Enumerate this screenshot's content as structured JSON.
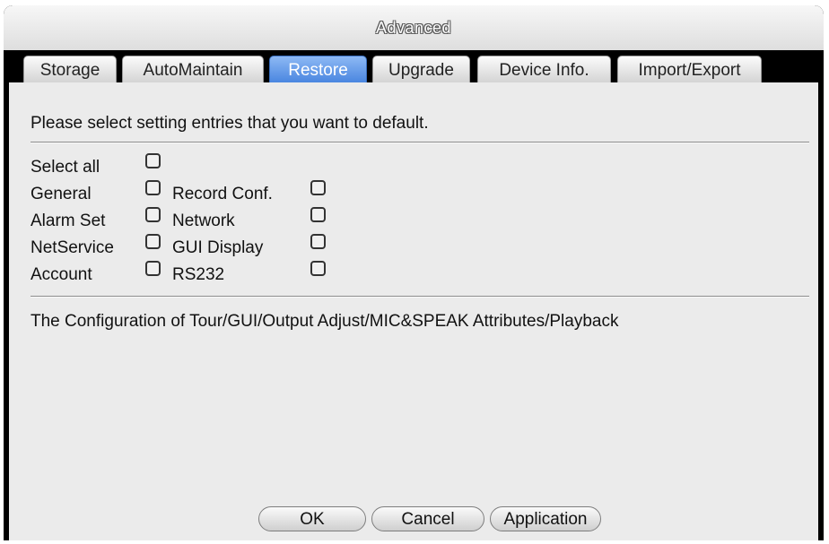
{
  "window": {
    "title": "Advanced"
  },
  "tabs": [
    {
      "label": "Storage",
      "active": false
    },
    {
      "label": "AutoMaintain",
      "active": false
    },
    {
      "label": "Restore",
      "active": true
    },
    {
      "label": "Upgrade",
      "active": false
    },
    {
      "label": "Device Info.",
      "active": false
    },
    {
      "label": "Import/Export",
      "active": false
    }
  ],
  "restore": {
    "instruction": "Please select setting entries that you want to default.",
    "select_all": {
      "label": "Select all",
      "checked": false
    },
    "options_left": [
      {
        "label": "General",
        "checked": false
      },
      {
        "label": "Alarm Set",
        "checked": false
      },
      {
        "label": "NetService",
        "checked": false
      },
      {
        "label": "Account",
        "checked": false
      }
    ],
    "options_right": [
      {
        "label": "Record Conf.",
        "checked": false
      },
      {
        "label": "Network",
        "checked": false
      },
      {
        "label": "GUI Display",
        "checked": false
      },
      {
        "label": "RS232",
        "checked": false
      }
    ],
    "description": "The Configuration of Tour/GUI/Output Adjust/MIC&SPEAK Attributes/Playback"
  },
  "buttons": {
    "ok": "OK",
    "cancel": "Cancel",
    "apply": "Application"
  },
  "colors": {
    "active_tab": "#4a86e0",
    "panel_bg": "#ebebeb",
    "frame": "#000000"
  }
}
